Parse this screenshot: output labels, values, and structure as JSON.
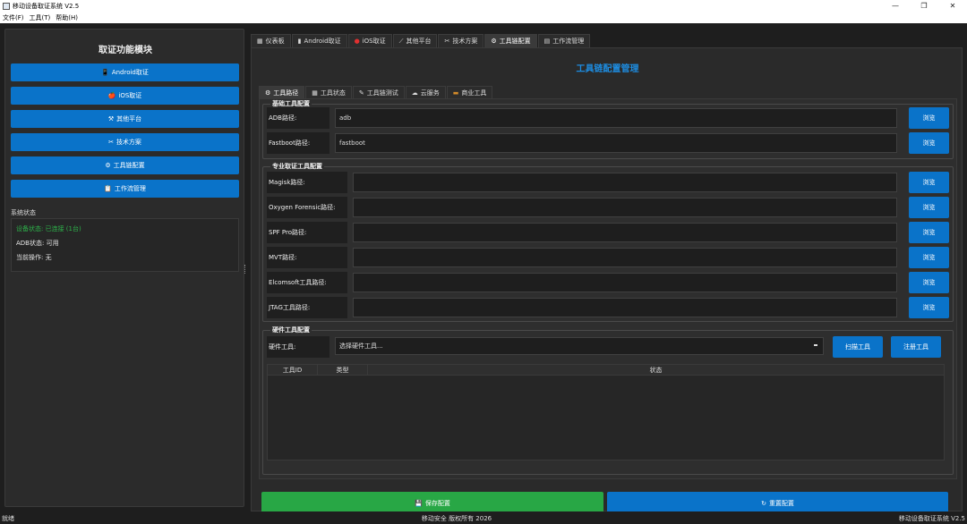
{
  "window": {
    "title": "移动设备取证系统 V2.5",
    "controls": [
      "—",
      "❐",
      "✕"
    ]
  },
  "menu": [
    "文件(F)",
    "工具(T)",
    "帮助(H)"
  ],
  "sidebar": {
    "title": "取证功能模块",
    "buttons": [
      {
        "icon": "📱",
        "label": "Android取证"
      },
      {
        "icon": "🍎",
        "label": "iOS取证"
      },
      {
        "icon": "⚒",
        "label": "其他平台"
      },
      {
        "icon": "✂",
        "label": "技术方案"
      },
      {
        "icon": "⚙",
        "label": "工具链配置"
      },
      {
        "icon": "📋",
        "label": "工作流管理"
      }
    ],
    "status_label": "系统状态",
    "status": {
      "device": "设备状态: 已连接 (1台)",
      "adb": "ADB状态: 可用",
      "operation": "当前操作: 无"
    },
    "status_device_color": "#2db34a"
  },
  "main_tabs": [
    {
      "icon": "▦",
      "label": "仪表板"
    },
    {
      "icon": "▮",
      "label": "Android取证"
    },
    {
      "icon": "●",
      "label": "iOS取证"
    },
    {
      "icon": "⟋",
      "label": "其他平台"
    },
    {
      "icon": "✂",
      "label": "技术方案"
    },
    {
      "icon": "⚙",
      "label": "工具链配置"
    },
    {
      "icon": "▤",
      "label": "工作流管理"
    }
  ],
  "active_main_tab": "工具链配置",
  "config": {
    "title": "工具链配置管理",
    "sub_tabs": [
      {
        "icon": "⚙",
        "label": "工具路径"
      },
      {
        "icon": "▦",
        "label": "工具状态"
      },
      {
        "icon": "✎",
        "label": "工具链测试"
      },
      {
        "icon": "☁",
        "label": "云服务"
      },
      {
        "icon": "▬",
        "label": "商业工具"
      }
    ],
    "basic_group": {
      "title": "基础工具配置",
      "rows": [
        {
          "label": "ADB路径:",
          "value": "adb",
          "browse": "浏览"
        },
        {
          "label": "Fastboot路径:",
          "value": "fastboot",
          "browse": "浏览"
        }
      ]
    },
    "pro_group": {
      "title": "专业取证工具配置",
      "rows": [
        {
          "label": "Magisk路径:",
          "value": "",
          "browse": "浏览"
        },
        {
          "label": "Oxygen Forensic路径:",
          "value": "",
          "browse": "浏览"
        },
        {
          "label": "SPF Pro路径:",
          "value": "",
          "browse": "浏览"
        },
        {
          "label": "MVT路径:",
          "value": "",
          "browse": "浏览"
        },
        {
          "label": "Elcomsoft工具路径:",
          "value": "",
          "browse": "浏览"
        },
        {
          "label": "JTAG工具路径:",
          "value": "",
          "browse": "浏览"
        }
      ]
    },
    "hw_group": {
      "title": "硬件工具配置",
      "label": "硬件工具:",
      "select_value": "选择硬件工具...",
      "scan_button": "扫描工具",
      "register_button": "注册工具",
      "table_headers": [
        "工具ID",
        "类型",
        "状态"
      ]
    },
    "save_button": {
      "icon": "💾",
      "label": "保存配置"
    },
    "reset_button": {
      "icon": "↻",
      "label": "重置配置"
    }
  },
  "statusbar": {
    "left": "就绪",
    "center": "移动安全 版权所有 2026",
    "right": "移动设备取证系统 V2.5"
  },
  "colors": {
    "accent": "#0a73c9",
    "save": "#28a745",
    "title_blue": "#1d8ce0"
  }
}
